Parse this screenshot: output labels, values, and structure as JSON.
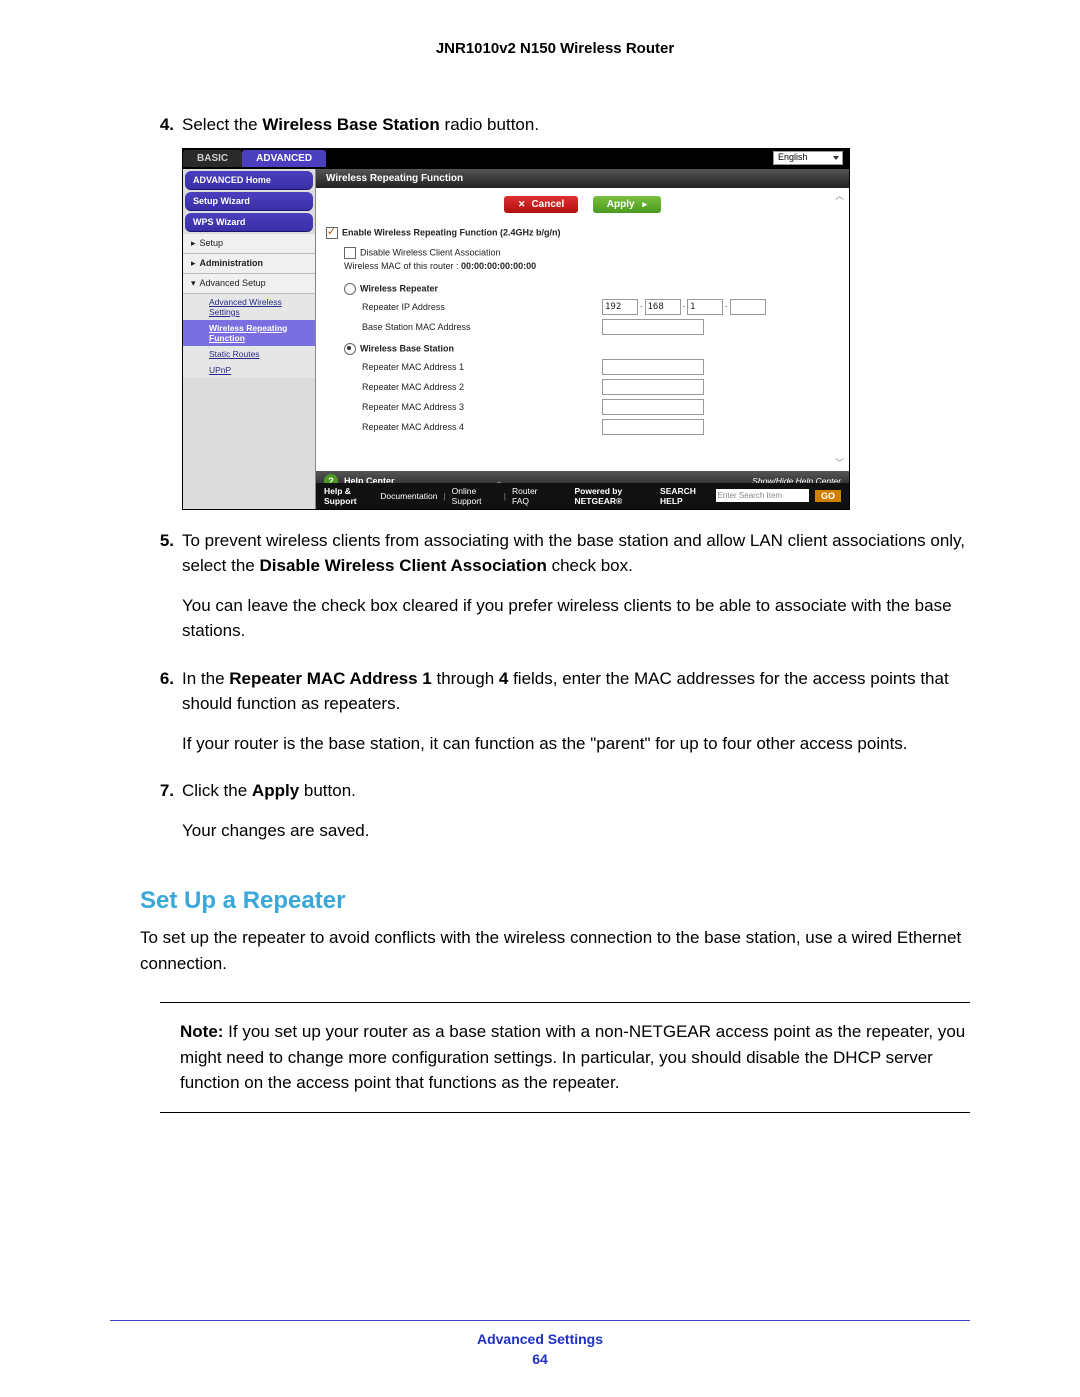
{
  "doc_title": "JNR1010v2 N150 Wireless Router",
  "steps": {
    "s4": {
      "num": "4.",
      "text_pre": "Select the ",
      "text_bold": "Wireless Base Station",
      "text_post": " radio button."
    },
    "s5": {
      "num": "5.",
      "p1_a": "To prevent wireless clients from associating with the base station and allow LAN client associations only, select the ",
      "p1_b": "Disable Wireless Client Association",
      "p1_c": " check box.",
      "p2": "You can leave the check box cleared if you prefer wireless clients to be able to associate with the base stations."
    },
    "s6": {
      "num": "6.",
      "p1_a": "In the ",
      "p1_b": "Repeater MAC Address 1",
      "p1_c": " through ",
      "p1_d": "4",
      "p1_e": " fields, enter the MAC addresses for the access points that should function as repeaters.",
      "p2": "If your router is the base station, it can function as the \"parent\" for up to four other access points."
    },
    "s7": {
      "num": "7.",
      "p1_a": "Click the ",
      "p1_b": "Apply",
      "p1_c": " button.",
      "p2": "Your changes are saved."
    }
  },
  "section_heading": "Set Up a Repeater",
  "section_intro": "To set up the repeater to avoid conflicts with the wireless connection to the base station, use a wired Ethernet connection.",
  "note": {
    "label": "Note:",
    "body": " If you set up your router as a base station with a non-NETGEAR access point as the repeater, you might need to change more configuration settings. In particular, you should disable the DHCP server function on the access point that functions as the repeater."
  },
  "footer": {
    "title": "Advanced Settings",
    "page": "64"
  },
  "ui": {
    "tabs": {
      "basic": "BASIC",
      "advanced": "ADVANCED"
    },
    "lang": "English",
    "sidebar": {
      "home": "ADVANCED Home",
      "setup_wizard": "Setup Wizard",
      "wps": "WPS Wizard",
      "setup": "Setup",
      "admin": "Administration",
      "adv": "Advanced Setup",
      "sub": {
        "aws": "Advanced Wireless Settings",
        "wrf": "Wireless Repeating Function",
        "sr": "Static Routes",
        "upnp": "UPnP"
      }
    },
    "panel": {
      "title": "Wireless Repeating Function",
      "cancel": "Cancel",
      "apply": "Apply",
      "enable": "Enable Wireless Repeating Function (2.4GHz b/g/n)",
      "disable_assoc": "Disable Wireless Client Association",
      "mac_label": "Wireless MAC of this router : ",
      "mac_val": "00:00:00:00:00:00",
      "repeater": "Wireless Repeater",
      "rep_ip": "Repeater IP Address",
      "ip": {
        "o1": "192",
        "o2": "168",
        "o3": "1",
        "o4": ""
      },
      "bs_mac": "Base Station MAC Address",
      "base": "Wireless Base Station",
      "rmac1": "Repeater MAC Address 1",
      "rmac2": "Repeater MAC Address 2",
      "rmac3": "Repeater MAC Address 3",
      "rmac4": "Repeater MAC Address 4"
    },
    "help": {
      "center": "Help Center",
      "showhide": "Show/Hide Help Center"
    },
    "bottom": {
      "hs": "Help & Support",
      "doc": "Documentation",
      "os": "Online Support",
      "faq": "Router FAQ",
      "pow": "Powered by NETGEAR®",
      "srch": "SEARCH HELP",
      "ph": "Enter Search Item",
      "go": "GO"
    }
  }
}
